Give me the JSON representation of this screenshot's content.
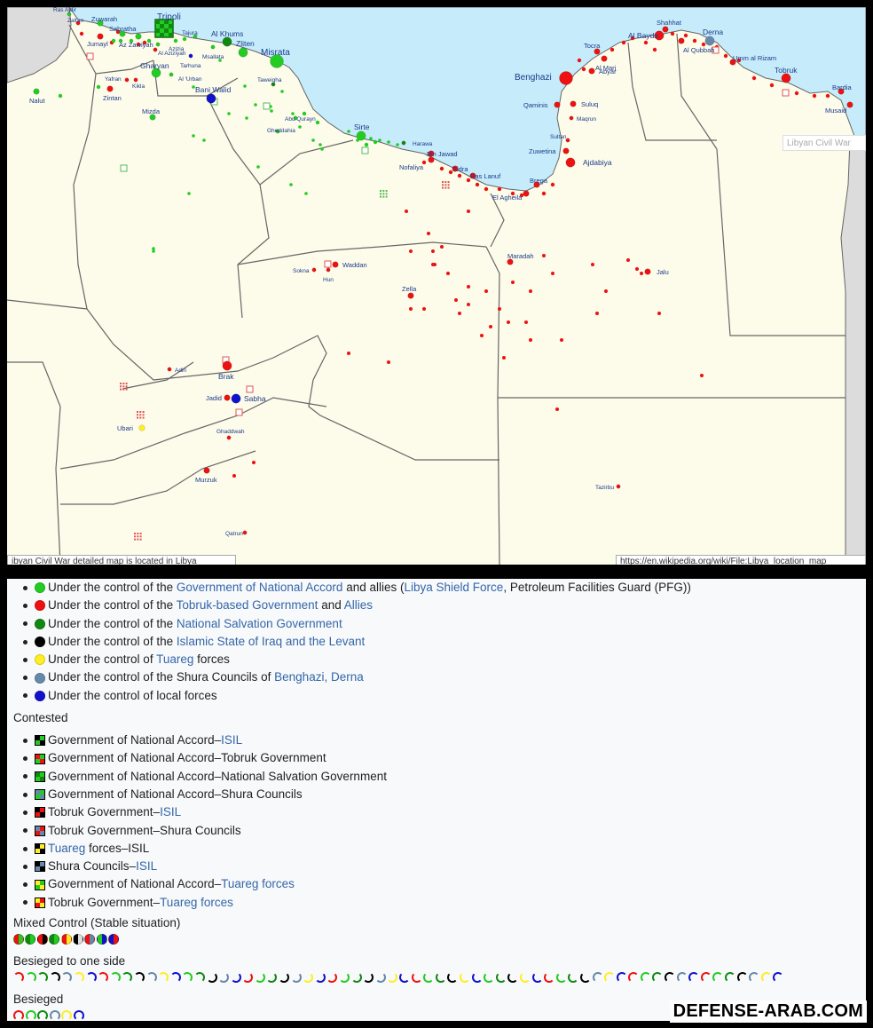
{
  "map": {
    "caption_left": "ibyan Civil War detailed map is located in Libya",
    "caption_right": "https://en.wikipedia.org/wiki/File:Libya_location_map",
    "caption_mid": "Libyan Civil War",
    "colors": {
      "land": "#fdfcea",
      "sea": "#c6ecfb",
      "foreign": "#dcdcdc",
      "border": "#666666",
      "gna": "#22cc22",
      "tobruk": "#ee1111",
      "nsg": "#118811",
      "isil": "#000000",
      "tuareg": "#ffee22",
      "shura": "#6688aa",
      "local": "#1111cc",
      "label": "#1a3a8a"
    },
    "places": [
      {
        "name": "Tripoli",
        "color": "gna",
        "size": "large",
        "label_big": true
      },
      {
        "name": "Zuwarah",
        "color": "gna",
        "size": "small"
      },
      {
        "name": "Sabratha",
        "color": "gna",
        "size": "small"
      },
      {
        "name": "Zaltan",
        "color": "tobruk",
        "size": "tiny"
      },
      {
        "name": "Ras Ajdir",
        "color": "gna",
        "size": "tiny"
      },
      {
        "name": "Jumayl",
        "color": "tobruk",
        "size": "small"
      },
      {
        "name": "Az Zawiyah",
        "color": "gna",
        "size": "small"
      },
      {
        "name": "Azizia",
        "color": "gna",
        "size": "tiny"
      },
      {
        "name": "Al Aziziyah",
        "color": "tobruk",
        "size": "tiny"
      },
      {
        "name": "Tajura",
        "color": "gna",
        "size": "tiny"
      },
      {
        "name": "Al Khums",
        "color": "nsg",
        "size": "medium"
      },
      {
        "name": "Zliten",
        "color": "gna",
        "size": "medium"
      },
      {
        "name": "Msallata",
        "color": "gna",
        "size": "tiny"
      },
      {
        "name": "Tarhuna",
        "color": "local",
        "size": "tiny"
      },
      {
        "name": "Misrata",
        "color": "gna",
        "size": "large"
      },
      {
        "name": "Gharyan",
        "color": "gna",
        "size": "medium"
      },
      {
        "name": "Al 'Urban",
        "color": "gna",
        "size": "tiny"
      },
      {
        "name": "Yafran",
        "color": "tobruk",
        "size": "tiny"
      },
      {
        "name": "Kikla",
        "color": "tobruk",
        "size": "tiny"
      },
      {
        "name": "Zintan",
        "color": "tobruk",
        "size": "small"
      },
      {
        "name": "Nalut",
        "color": "gna",
        "size": "small"
      },
      {
        "name": "Bani Walid",
        "color": "local",
        "size": "medium"
      },
      {
        "name": "Taweigha",
        "color": "nsg",
        "size": "tiny"
      },
      {
        "name": "Mizda",
        "color": "gna",
        "size": "small"
      },
      {
        "name": "Abu Qurayn",
        "color": "gna",
        "size": "tiny"
      },
      {
        "name": "Gheddahia",
        "color": "gna",
        "size": "tiny"
      },
      {
        "name": "Sirte",
        "color": "gna",
        "size": "medium"
      },
      {
        "name": "Harawa",
        "color": "nsg",
        "size": "tiny"
      },
      {
        "name": "Bin Jawad",
        "color": "tobruk",
        "size": "small"
      },
      {
        "name": "Nofaliya",
        "color": "tobruk",
        "size": "small"
      },
      {
        "name": "Sidra",
        "color": "tobruk",
        "size": "small"
      },
      {
        "name": "Ras Lanuf",
        "color": "tobruk",
        "size": "small"
      },
      {
        "name": "Brega",
        "color": "tobruk",
        "size": "small"
      },
      {
        "name": "El Agheila",
        "color": "tobruk",
        "size": "small"
      },
      {
        "name": "Benghazi",
        "color": "tobruk",
        "size": "large"
      },
      {
        "name": "Qaminis",
        "color": "tobruk",
        "size": "small"
      },
      {
        "name": "Suluq",
        "color": "tobruk",
        "size": "small"
      },
      {
        "name": "Maqrun",
        "color": "tobruk",
        "size": "tiny"
      },
      {
        "name": "Sultan",
        "color": "tobruk",
        "size": "tiny"
      },
      {
        "name": "Zuwetina",
        "color": "tobruk",
        "size": "small"
      },
      {
        "name": "Ajdabiya",
        "color": "tobruk",
        "size": "medium"
      },
      {
        "name": "Tocra",
        "color": "tobruk",
        "size": "small"
      },
      {
        "name": "Al Marj",
        "color": "tobruk",
        "size": "small"
      },
      {
        "name": "Abyar",
        "color": "tobruk",
        "size": "small"
      },
      {
        "name": "Al Bayda",
        "color": "tobruk",
        "size": "medium"
      },
      {
        "name": "Shahhat",
        "color": "tobruk",
        "size": "small"
      },
      {
        "name": "Al Qubbah",
        "color": "tobruk",
        "size": "small"
      },
      {
        "name": "Derna",
        "color": "shura",
        "size": "medium"
      },
      {
        "name": "Umm al Rizam",
        "color": "tobruk",
        "size": "small"
      },
      {
        "name": "Tobruk",
        "color": "tobruk",
        "size": "medium"
      },
      {
        "name": "Bardia",
        "color": "tobruk",
        "size": "small"
      },
      {
        "name": "Musaid",
        "color": "tobruk",
        "size": "small"
      },
      {
        "name": "Waddan",
        "color": "tobruk",
        "size": "small"
      },
      {
        "name": "Sokna",
        "color": "tobruk",
        "size": "tiny"
      },
      {
        "name": "Hun",
        "color": "tobruk",
        "size": "tiny"
      },
      {
        "name": "Zella",
        "color": "tobruk",
        "size": "small"
      },
      {
        "name": "Maradah",
        "color": "tobruk",
        "size": "small"
      },
      {
        "name": "Jalu",
        "color": "tobruk",
        "size": "small"
      },
      {
        "name": "Adiri",
        "color": "tobruk",
        "size": "tiny"
      },
      {
        "name": "Brak",
        "color": "tobruk",
        "size": "medium"
      },
      {
        "name": "Jadid",
        "color": "tobruk",
        "size": "small"
      },
      {
        "name": "Sabha",
        "color": "local",
        "size": "medium"
      },
      {
        "name": "Ubari",
        "color": "tuareg",
        "size": "small"
      },
      {
        "name": "Ghaddwah",
        "color": "tobruk",
        "size": "tiny"
      },
      {
        "name": "Murzuk",
        "color": "tobruk",
        "size": "small"
      },
      {
        "name": "Qatrun",
        "color": "tobruk",
        "size": "tiny"
      },
      {
        "name": "Tazirbu",
        "color": "tobruk",
        "size": "tiny"
      }
    ]
  },
  "legend": {
    "controlled": [
      {
        "color": "#22cc22",
        "parts": [
          "Under the control of the ",
          "Government of National Accord",
          " and allies (",
          "Libya Shield Force",
          ", Petroleum Facilities Guard (PFG))"
        ]
      },
      {
        "color": "#ee1111",
        "parts": [
          "Under the control of the ",
          "Tobruk-based Government",
          " and ",
          "Allies",
          ""
        ]
      },
      {
        "color": "#118811",
        "parts": [
          "Under the control of the ",
          "National Salvation Government",
          "",
          "",
          ""
        ]
      },
      {
        "color": "#000000",
        "parts": [
          "Under the control of the ",
          "Islamic State of Iraq and the Levant",
          "",
          "",
          ""
        ]
      },
      {
        "color": "#ffee22",
        "parts": [
          "Under the control of ",
          "Tuareg",
          " forces",
          "",
          ""
        ]
      },
      {
        "color": "#6688aa",
        "parts": [
          "Under the control of the Shura Councils of ",
          "Benghazi, Derna",
          "",
          "",
          ""
        ]
      },
      {
        "color": "#1111cc",
        "parts": [
          "Under the control of local forces",
          "",
          "",
          "",
          ""
        ]
      }
    ],
    "contested_title": "Contested",
    "contested": [
      {
        "c1": "#22cc22",
        "c2": "#000000",
        "parts": [
          "Government of National Accord–",
          "ISIL",
          ""
        ]
      },
      {
        "c1": "#22cc22",
        "c2": "#ee1111",
        "parts": [
          "Government of National Accord–Tobruk Government",
          "",
          ""
        ]
      },
      {
        "c1": "#22cc22",
        "c2": "#118811",
        "parts": [
          "Government of National Accord–National Salvation Government",
          "",
          ""
        ]
      },
      {
        "c1": "#22cc22",
        "c2": "#6688aa",
        "parts": [
          "Government of National Accord–Shura Councils",
          "",
          ""
        ]
      },
      {
        "c1": "#ee1111",
        "c2": "#000000",
        "parts": [
          "Tobruk Government–",
          "ISIL",
          ""
        ]
      },
      {
        "c1": "#ee1111",
        "c2": "#6688aa",
        "parts": [
          "Tobruk Government–Shura Councils",
          "",
          ""
        ]
      },
      {
        "c1": "#ffee22",
        "c2": "#000000",
        "parts": [
          "",
          "Tuareg",
          " forces–ISIL"
        ]
      },
      {
        "c1": "#6688aa",
        "c2": "#000000",
        "parts": [
          "Shura Councils–",
          "ISIL",
          ""
        ]
      },
      {
        "c1": "#22cc22",
        "c2": "#ffee22",
        "parts": [
          "Government of National Accord–",
          "Tuareg forces",
          ""
        ]
      },
      {
        "c1": "#ee1111",
        "c2": "#ffee22",
        "parts": [
          "Tobruk Government–",
          "Tuareg forces",
          ""
        ]
      }
    ],
    "mixed_title": "Mixed Control (Stable situation)",
    "mixed": [
      [
        "#ee1111",
        "#22cc22"
      ],
      [
        "#118811",
        "#22cc22"
      ],
      [
        "#ee1111",
        "#000000"
      ],
      [
        "#118811",
        "#22cc22"
      ],
      [
        "#ee1111",
        "#ffee22"
      ],
      [
        "#000000",
        "#dddddd"
      ],
      [
        "#ee1111",
        "#6688aa"
      ],
      [
        "#22cc22",
        "#1111cc"
      ],
      [
        "#1111cc",
        "#ee1111"
      ]
    ],
    "besieged_one_title": "Besieged to one side",
    "besieged_one": [
      "#ee1111",
      "#22cc22",
      "#118811",
      "#000000",
      "#6688aa",
      "#ffee22",
      "#1111cc",
      "#ee1111",
      "#22cc22",
      "#118811",
      "#000000",
      "#6688aa",
      "#ffee22",
      "#1111cc",
      "#22cc22",
      "#118811",
      "#000000",
      "#6688aa",
      "#1111cc",
      "#ee1111",
      "#22cc22",
      "#118811",
      "#000000",
      "#6688aa",
      "#ffee22",
      "#1111cc",
      "#ee1111",
      "#22cc22",
      "#118811",
      "#000000",
      "#6688aa",
      "#ffee22",
      "#1111cc",
      "#ee1111",
      "#22cc22",
      "#118811",
      "#000000",
      "#ffee22",
      "#1111cc",
      "#22cc22",
      "#118811",
      "#000000",
      "#ffee22",
      "#1111cc",
      "#ee1111",
      "#22cc22",
      "#118811",
      "#000000",
      "#6688aa",
      "#ffee22",
      "#1111cc",
      "#ee1111",
      "#22cc22",
      "#118811",
      "#000000",
      "#6688aa",
      "#1111cc",
      "#ee1111",
      "#22cc22",
      "#118811",
      "#000000",
      "#6688aa",
      "#ffee22",
      "#1111cc"
    ],
    "besieged_title": "Besieged",
    "besieged": [
      "#ee1111",
      "#22cc22",
      "#118811",
      "#6688aa",
      "#ffee22",
      "#1111cc"
    ]
  },
  "watermark": "DEFENSE-ARAB.COM"
}
